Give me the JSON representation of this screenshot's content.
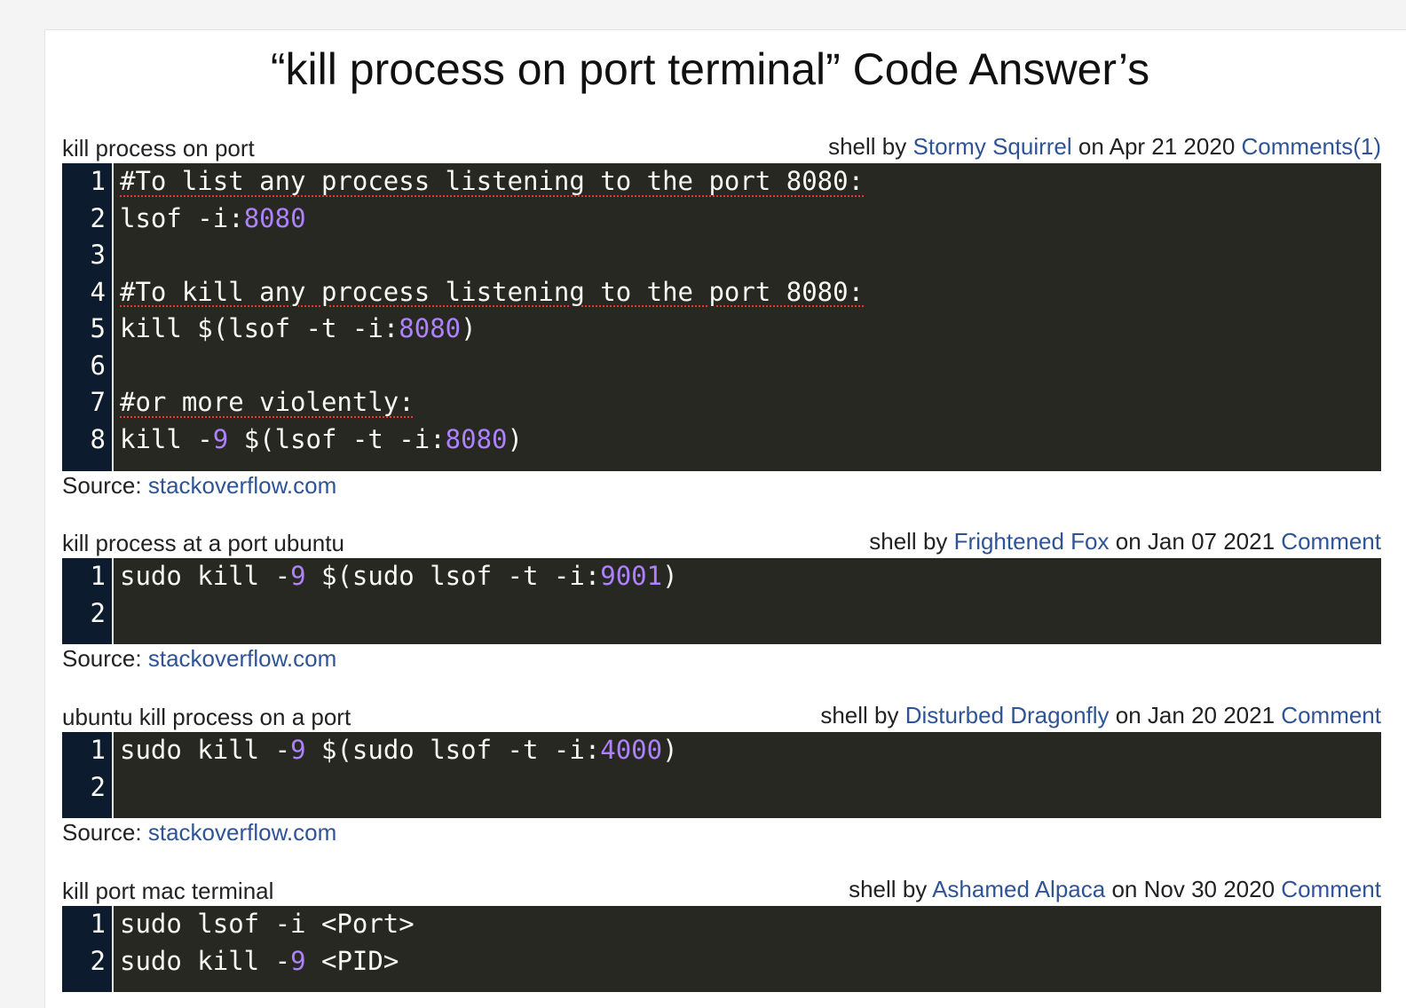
{
  "page_title": "“kill process on port terminal” Code Answer’s",
  "answers": [
    {
      "title": "kill process on port",
      "lang": "shell",
      "by_word": "by",
      "author": "Stormy Squirrel",
      "on_word": "on",
      "date": "Apr 21 2020",
      "comment_label": "Comments(1)",
      "source_label": "Source:",
      "source": "stackoverflow.com",
      "line_numbers": [
        "1",
        "2",
        "3",
        "4",
        "5",
        "6",
        "7",
        "8"
      ],
      "code": {
        "l1": "#To list any process listening to the port 8080:",
        "l2a": "lsof -i:",
        "l2b": "8080",
        "l4": "#To kill any process listening to the port 8080:",
        "l5a": "kill $(lsof -t -i:",
        "l5b": "8080",
        "l5c": ")",
        "l7": "#or more violently:",
        "l8a": "kill -",
        "l8b": "9",
        "l8c": " $(lsof -t -i:",
        "l8d": "8080",
        "l8e": ")"
      }
    },
    {
      "title": "kill process at a port ubuntu",
      "lang": "shell",
      "by_word": "by",
      "author": "Frightened Fox",
      "on_word": "on",
      "date": "Jan 07 2021",
      "comment_label": "Comment",
      "source_label": "Source:",
      "source": "stackoverflow.com",
      "line_numbers": [
        "1",
        "2"
      ],
      "code": {
        "l1a": "sudo kill -",
        "l1b": "9",
        "l1c": " $(sudo lsof -t -i:",
        "l1d": "9001",
        "l1e": ")"
      }
    },
    {
      "title": "ubuntu kill process on a port",
      "lang": "shell",
      "by_word": "by",
      "author": "Disturbed Dragonfly",
      "on_word": "on",
      "date": "Jan 20 2021",
      "comment_label": "Comment",
      "source_label": "Source:",
      "source": "stackoverflow.com",
      "line_numbers": [
        "1",
        "2"
      ],
      "code": {
        "l1a": "sudo kill -",
        "l1b": "9",
        "l1c": " $(sudo lsof -t -i:",
        "l1d": "4000",
        "l1e": ")"
      }
    },
    {
      "title": "kill port mac terminal",
      "lang": "shell",
      "by_word": "by",
      "author": "Ashamed Alpaca",
      "on_word": "on",
      "date": "Nov 30 2020",
      "comment_label": "Comment",
      "line_numbers": [
        "1",
        "2"
      ],
      "code": {
        "l1": "sudo lsof -i <Port>",
        "l2a": "sudo kill -",
        "l2b": "9",
        "l2c": " <PID>"
      }
    }
  ]
}
